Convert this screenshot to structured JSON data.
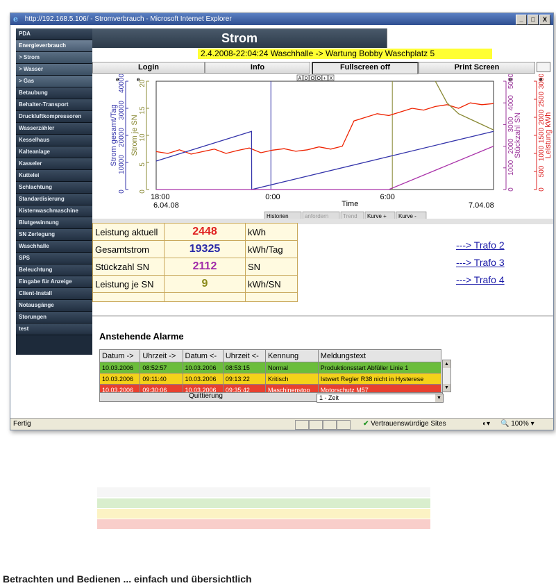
{
  "window": {
    "title": "http://192.168.5.106/ - Stromverbrauch - Microsoft Internet Explorer",
    "buttons": [
      "_",
      "□",
      "X"
    ]
  },
  "sidebar": {
    "items": [
      {
        "label": "PDA"
      },
      {
        "label": "Energieverbrauch"
      },
      {
        "label": "> Strom"
      },
      {
        "label": "> Wasser"
      },
      {
        "label": "> Gas"
      },
      {
        "label": "Betaubung"
      },
      {
        "label": "Behalter-Transport"
      },
      {
        "label": "Druckluftkompressoren"
      },
      {
        "label": "Wasserzähler"
      },
      {
        "label": "Kesselhaus"
      },
      {
        "label": "Kalteanlage"
      },
      {
        "label": "Kasseler"
      },
      {
        "label": "Kuttelei"
      },
      {
        "label": "Schlachtung"
      },
      {
        "label": "Standardisierung"
      },
      {
        "label": "Kistenwaschmaschine"
      },
      {
        "label": "Blutgewinnung"
      },
      {
        "label": "SN Zerlegung"
      },
      {
        "label": "Waschhalle"
      },
      {
        "label": "SPS"
      },
      {
        "label": "Beleuchtung"
      },
      {
        "label": "Eingabe für Anzeige"
      },
      {
        "label": "Client-Install"
      },
      {
        "label": "Notausgänge"
      },
      {
        "label": "Storungen"
      },
      {
        "label": "test"
      }
    ]
  },
  "header": {
    "title": "Strom",
    "marquee": "2.4.2008-22:04:24 Waschhalle -> Wartung Bobby Waschplatz 5"
  },
  "toolbar": {
    "login": "Login",
    "info": "Info",
    "fullscreen": "Fullscreen off",
    "print": "Print Screen"
  },
  "chart_data": {
    "type": "line",
    "xlabel": "Time",
    "x_ticks": [
      "18:00",
      "0:00",
      "6:00"
    ],
    "x_dates": [
      "6.04.08",
      "7.04.08"
    ],
    "left_axes": [
      {
        "label": "Strom gesamt/Tag",
        "ticks": [
          "0",
          "10000",
          "20000",
          "30000",
          "40000"
        ],
        "ylim": [
          0,
          40000
        ],
        "color": "#3333aa"
      },
      {
        "label": "Strom je SN",
        "ticks": [
          "0",
          "5",
          "10",
          "15",
          "20"
        ],
        "ylim": [
          0,
          20
        ],
        "color": "#888833"
      }
    ],
    "right_axes": [
      {
        "label": "Stückzahl SN",
        "ticks": [
          "0",
          "1000",
          "2000",
          "3000",
          "4000",
          "5000"
        ],
        "ylim": [
          0,
          5000
        ],
        "color": "#993399"
      },
      {
        "label": "Leistung kWh",
        "ticks": [
          "0",
          "500",
          "1000",
          "1500",
          "2000",
          "2500",
          "3000"
        ],
        "ylim": [
          0,
          3000
        ],
        "color": "#dd2222"
      }
    ],
    "mini_buttons": [
      "A",
      "D",
      "O",
      "O",
      "+",
      "X"
    ],
    "nav_buttons": [
      "Historien",
      "anfordern",
      "Trend",
      "Kurve +",
      "Kurve -"
    ],
    "series": [
      {
        "axis": "Leistung kWh",
        "color": "#ee2200",
        "x": [
          0,
          1,
          2,
          3,
          4,
          5,
          6,
          7,
          8,
          9,
          10,
          11,
          12,
          13,
          14,
          15,
          16,
          17,
          18,
          19,
          20,
          21,
          22,
          23,
          24,
          25,
          26,
          27,
          28,
          29
        ],
        "values": [
          1050,
          1000,
          1100,
          980,
          1050,
          1120,
          1000,
          1080,
          1150,
          1020,
          1090,
          1130,
          1060,
          1100,
          1180,
          1120,
          1200,
          1900,
          2000,
          2100,
          2050,
          2150,
          2250,
          2200,
          2300,
          2350,
          2250,
          2400,
          2350,
          2380
        ]
      },
      {
        "axis": "Strom gesamt/Tag",
        "color": "#3333aa",
        "x": [
          0,
          8.2,
          8.21,
          29
        ],
        "values": [
          10500,
          21500,
          0,
          21500
        ]
      },
      {
        "axis": "Stückzahl SN",
        "color": "#aa33aa",
        "x": [
          0,
          20,
          29
        ],
        "values": [
          0,
          0,
          2000
        ]
      },
      {
        "axis": "Strom je SN",
        "color": "#888833",
        "x": [
          24,
          25,
          26,
          27,
          28,
          29
        ],
        "values": [
          20,
          16,
          14,
          13,
          12,
          11
        ]
      }
    ]
  },
  "info": {
    "rows": [
      {
        "label": "Leistung aktuell",
        "value": "2448",
        "unit": "kWh",
        "color": "#e02020"
      },
      {
        "label": "Gesamtstrom",
        "value": "19325",
        "unit": "kWh/Tag",
        "color": "#2a2aa8"
      },
      {
        "label": "Stückzahl SN",
        "value": "2112",
        "unit": "SN",
        "color": "#a02aa8"
      },
      {
        "label": "Leistung je SN",
        "value": "9",
        "unit": "kWh/SN",
        "color": "#8a8a1a"
      }
    ]
  },
  "trafo": [
    "---> Trafo 2",
    "---> Trafo 3",
    "---> Trafo 4"
  ],
  "alarms": {
    "title": "Anstehende Alarme",
    "columns": [
      "Datum ->",
      "Uhrzeit ->",
      "Datum <-",
      "Uhrzeit <-",
      "Kennung",
      "Meldungstext"
    ],
    "rows": [
      {
        "c": [
          "10.03.2006",
          "08:52:57",
          "10.03.2006",
          "08:53:15",
          "Normal",
          "Produktionsstart Abfüller Linie 1"
        ],
        "status": "green"
      },
      {
        "c": [
          "10.03.2006",
          "09:11:40",
          "10.03.2006",
          "09:13:22",
          "Kritisch",
          "Istwert Regler R38 nicht in Hysterese"
        ],
        "status": "yellow"
      },
      {
        "c": [
          "10.03.2006",
          "09:30:06",
          "10.03.2006",
          "09:35:42",
          "Maschinenstop",
          "Motorschutz M57"
        ],
        "status": "red"
      }
    ],
    "quitt": "Quittierung",
    "sort_value": "1 - Zeit"
  },
  "statusbar": {
    "left": "Fertig",
    "trust": "Vertrauenswürdige Sites",
    "zoom": "100%"
  },
  "footer": {
    "text": "Betrachten und Bedienen ... einfach und übersichtlich"
  }
}
